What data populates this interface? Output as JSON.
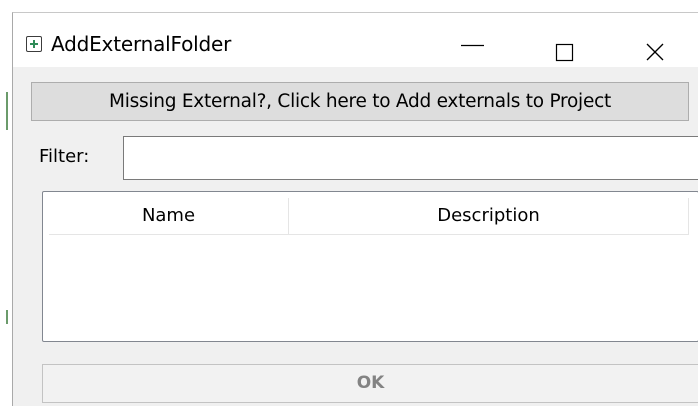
{
  "window": {
    "title": "AddExternalFolder",
    "app_icon": "plus-square-icon",
    "controls": {
      "minimize_icon": "minimize-icon",
      "maximize_icon": "maximize-icon",
      "close_icon": "close-icon"
    }
  },
  "add_externals_button": {
    "label": "Missing External?, Click here to Add externals to Project"
  },
  "filter": {
    "label": "Filter:",
    "value": "",
    "placeholder": ""
  },
  "list": {
    "columns": [
      "Name",
      "Description"
    ],
    "rows": []
  },
  "ok_button": {
    "label": "OK",
    "enabled": false
  },
  "colors": {
    "app_icon_accent": "#2e8b57",
    "button_bg": "#dddddd",
    "disabled_text": "#838383"
  }
}
